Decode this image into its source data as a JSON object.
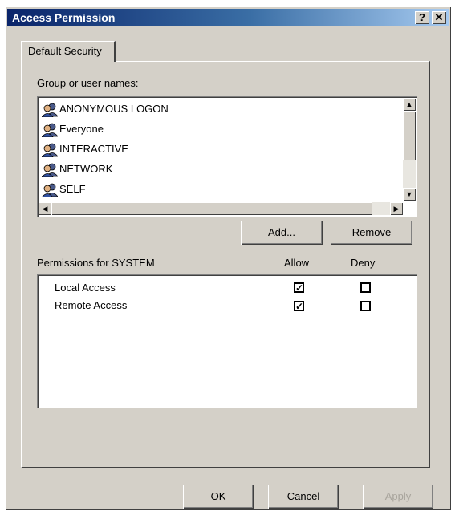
{
  "window": {
    "title": "Access Permission",
    "help_glyph": "?",
    "close_glyph": "✕"
  },
  "tabs": [
    {
      "label": "Default Security"
    }
  ],
  "groups": {
    "label": "Group or user names:",
    "items": [
      {
        "name": "ANONYMOUS LOGON",
        "icon": "users-icon"
      },
      {
        "name": "Everyone",
        "icon": "users-icon"
      },
      {
        "name": "INTERACTIVE",
        "icon": "users-icon"
      },
      {
        "name": "NETWORK",
        "icon": "users-icon"
      },
      {
        "name": "SELF",
        "icon": "users-icon"
      }
    ],
    "scroll_up": "▲",
    "scroll_down": "▼",
    "scroll_left": "◀",
    "scroll_right": "▶"
  },
  "buttons": {
    "add": "Add...",
    "remove": "Remove",
    "ok": "OK",
    "cancel": "Cancel",
    "apply": "Apply"
  },
  "permissions": {
    "header": "Permissions for SYSTEM",
    "allow_label": "Allow",
    "deny_label": "Deny",
    "rows": [
      {
        "name": "Local Access",
        "allow": true,
        "deny": false
      },
      {
        "name": "Remote Access",
        "allow": true,
        "deny": false
      }
    ]
  },
  "colors": {
    "face": "#d4d0c8",
    "title_start": "#0a246a",
    "title_end": "#a6caf0"
  }
}
